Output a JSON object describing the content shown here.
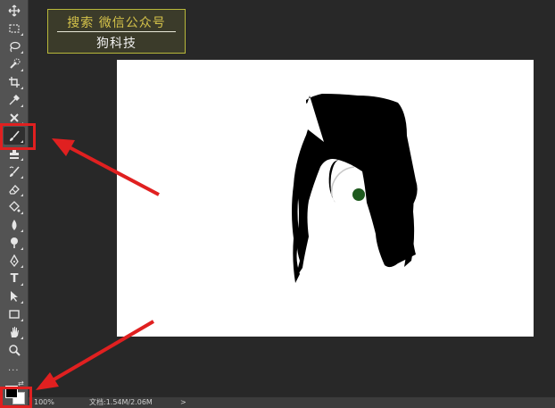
{
  "toolbar": {
    "tools": [
      {
        "name": "move-tool",
        "icon": "move-icon",
        "selected": false
      },
      {
        "name": "marquee-tool",
        "icon": "marquee-icon",
        "selected": false
      },
      {
        "name": "lasso-tool",
        "icon": "lasso-icon",
        "selected": false
      },
      {
        "name": "quick-selection-tool",
        "icon": "quick-selection-icon",
        "selected": false
      },
      {
        "name": "crop-tool",
        "icon": "crop-icon",
        "selected": false
      },
      {
        "name": "eyedropper-tool",
        "icon": "eyedropper-icon",
        "selected": false
      },
      {
        "name": "spot-healing-tool",
        "icon": "healing-icon",
        "selected": false
      },
      {
        "name": "brush-tool",
        "icon": "brush-icon",
        "selected": true
      },
      {
        "name": "clone-stamp-tool",
        "icon": "stamp-icon",
        "selected": false
      },
      {
        "name": "history-brush-tool",
        "icon": "history-brush-icon",
        "selected": false
      },
      {
        "name": "eraser-tool",
        "icon": "eraser-icon",
        "selected": false
      },
      {
        "name": "paint-bucket-tool",
        "icon": "bucket-icon",
        "selected": false
      },
      {
        "name": "blur-tool",
        "icon": "blur-icon",
        "selected": false
      },
      {
        "name": "dodge-tool",
        "icon": "dodge-icon",
        "selected": false
      },
      {
        "name": "pen-tool",
        "icon": "pen-icon",
        "selected": false
      },
      {
        "name": "type-tool",
        "icon": "type-icon",
        "label": "T",
        "selected": false
      },
      {
        "name": "path-selection-tool",
        "icon": "path-selection-icon",
        "selected": false
      },
      {
        "name": "rectangle-tool",
        "icon": "rectangle-icon",
        "selected": false
      },
      {
        "name": "hand-tool",
        "icon": "hand-icon",
        "selected": false
      },
      {
        "name": "zoom-tool",
        "icon": "zoom-icon",
        "selected": false
      }
    ],
    "more_label": "···",
    "foreground_color": "#000000",
    "background_color": "#ffffff"
  },
  "watermark": {
    "line1": "搜索 微信公众号",
    "line2": "狗科技",
    "text_color": "#d4c24a",
    "border_color": "#b8b83a"
  },
  "status_bar": {
    "zoom": "100%",
    "doc_size": "文档:1.54M/2.06M",
    "arrow": ">"
  },
  "colors": {
    "workspace": "#282828",
    "toolbar": "#535353",
    "highlight": "#e02020",
    "brush_cursor_dot": "#1e5a1e"
  }
}
